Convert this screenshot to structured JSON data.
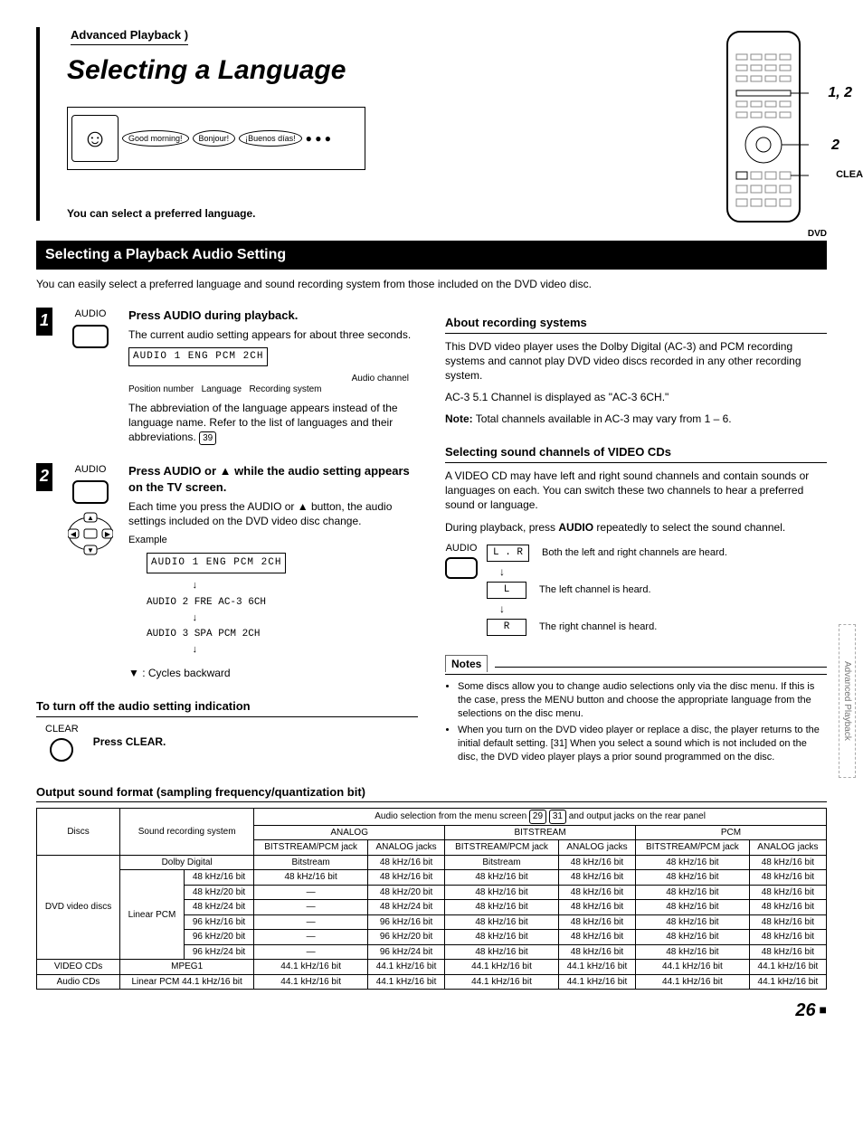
{
  "header": {
    "breadcrumb": "Advanced Playback",
    "title": "Selecting a Language",
    "greetings": [
      "Good morning!",
      "Bonjour!",
      "¡Buenos días!"
    ],
    "intro_note": "You can select a preferred language."
  },
  "remote": {
    "callout_12": "1, 2",
    "callout_2": "2",
    "callout_clear": "CLEAR"
  },
  "section1": {
    "bar": "Selecting a Playback Audio Setting",
    "dvd_tag": "DVD",
    "lead": "You can easily select a preferred language and sound recording system from those included on the DVD video disc."
  },
  "step1": {
    "num": "1",
    "label": "AUDIO",
    "heading": "Press AUDIO during playback.",
    "p1": "The current audio setting appears for about three seconds.",
    "display": "AUDIO 1 ENG PCM 2CH",
    "caption_audio_channel": "Audio channel",
    "caption_position": "Position number",
    "caption_language": "Language",
    "caption_recsys": "Recording system",
    "p2": "The abbreviation of the language appears instead of the language name. Refer to the list of languages and their abbreviations.",
    "ref": "39"
  },
  "step2": {
    "num": "2",
    "label": "AUDIO",
    "heading": "Press AUDIO or ▲ while the audio setting appears on the TV screen.",
    "p1": "Each time you press the AUDIO or ▲ button, the audio settings included on the DVD video disc change.",
    "example_label": "Example",
    "examples": [
      "AUDIO 1 ENG PCM 2CH",
      "AUDIO 2 FRE AC-3 6CH",
      "AUDIO 3 SPA PCM 2CH"
    ],
    "cycles": "▼ : Cycles backward"
  },
  "turnoff": {
    "heading": "To turn off the audio setting indication",
    "label": "CLEAR",
    "instruction": "Press CLEAR."
  },
  "about": {
    "heading": "About recording systems",
    "p1": "This DVD video player uses the Dolby Digital (AC-3) and PCM recording systems and cannot play DVD video discs recorded in any other recording system.",
    "p2": "AC-3 5.1 Channel is displayed as \"AC-3 6CH.\"",
    "note_label": "Note:",
    "note": "Total channels available in AC-3 may vary from 1 – 6."
  },
  "vcd": {
    "heading": "Selecting sound channels of VIDEO CDs",
    "p1": "A VIDEO CD may have left and right sound channels and contain sounds or languages on each. You can switch these two channels to hear a preferred sound or language.",
    "p2_pre": "During playback, press ",
    "p2_bold": "AUDIO",
    "p2_post": " repeatedly to select the sound channel.",
    "label": "AUDIO",
    "channels": [
      {
        "code": "L . R",
        "desc": "Both the left and right channels are heard."
      },
      {
        "code": "L",
        "desc": "The left channel is heard."
      },
      {
        "code": "R",
        "desc": "The right channel is heard."
      }
    ]
  },
  "notes": {
    "heading": "Notes",
    "items": [
      "Some discs allow you to change audio selections only via the disc menu. If this is the case, press the MENU button and choose the appropriate language from the selections on the disc menu.",
      "When you turn on the DVD video player or replace a disc, the player returns to the initial default setting. [31]  When you select a sound which is not included on the disc, the DVD video player plays a prior sound programmed on the disc."
    ]
  },
  "output": {
    "heading": "Output sound format (sampling frequency/quantization bit)",
    "top_header_pre": "Audio selection from the menu screen ",
    "top_header_ref1": "29",
    "top_header_ref2": "31",
    "top_header_post": " and output jacks on the rear panel",
    "col_discs": "Discs",
    "col_srs": "Sound recording system",
    "groups": [
      "ANALOG",
      "BITSTREAM",
      "PCM"
    ],
    "sub_cols": [
      "BITSTREAM/PCM jack",
      "ANALOG jacks"
    ],
    "rows": [
      {
        "disc": "DVD video discs",
        "srs": "Dolby Digital",
        "srs2": "",
        "v": [
          "Bitstream",
          "48 kHz/16 bit",
          "Bitstream",
          "48 kHz/16 bit",
          "48 kHz/16 bit",
          "48 kHz/16 bit"
        ]
      },
      {
        "disc": "",
        "srs": "Linear PCM",
        "srs2": "48 kHz/16 bit",
        "v": [
          "48 kHz/16 bit",
          "48 kHz/16 bit",
          "48 kHz/16 bit",
          "48 kHz/16 bit",
          "48 kHz/16 bit",
          "48 kHz/16 bit"
        ]
      },
      {
        "disc": "",
        "srs": "",
        "srs2": "48 kHz/20 bit",
        "v": [
          "—",
          "48 kHz/20 bit",
          "48 kHz/16 bit",
          "48 kHz/16 bit",
          "48 kHz/16 bit",
          "48 kHz/16 bit"
        ]
      },
      {
        "disc": "",
        "srs": "",
        "srs2": "48 kHz/24 bit",
        "v": [
          "—",
          "48 kHz/24 bit",
          "48 kHz/16 bit",
          "48 kHz/16 bit",
          "48 kHz/16 bit",
          "48 kHz/16 bit"
        ]
      },
      {
        "disc": "",
        "srs": "",
        "srs2": "96 kHz/16 bit",
        "v": [
          "—",
          "96 kHz/16 bit",
          "48 kHz/16 bit",
          "48 kHz/16 bit",
          "48 kHz/16 bit",
          "48 kHz/16 bit"
        ]
      },
      {
        "disc": "",
        "srs": "",
        "srs2": "96 kHz/20 bit",
        "v": [
          "—",
          "96 kHz/20 bit",
          "48 kHz/16 bit",
          "48 kHz/16 bit",
          "48 kHz/16 bit",
          "48 kHz/16 bit"
        ]
      },
      {
        "disc": "",
        "srs": "",
        "srs2": "96 kHz/24 bit",
        "v": [
          "—",
          "96 kHz/24 bit",
          "48 kHz/16 bit",
          "48 kHz/16 bit",
          "48 kHz/16 bit",
          "48 kHz/16 bit"
        ]
      },
      {
        "disc": "VIDEO CDs",
        "srs": "MPEG1",
        "srs2": "",
        "v": [
          "44.1 kHz/16 bit",
          "44.1 kHz/16 bit",
          "44.1 kHz/16 bit",
          "44.1 kHz/16 bit",
          "44.1 kHz/16 bit",
          "44.1 kHz/16 bit"
        ]
      },
      {
        "disc": "Audio CDs",
        "srs": "Linear PCM 44.1 kHz/16 bit",
        "srs2": "",
        "v": [
          "44.1 kHz/16 bit",
          "44.1 kHz/16 bit",
          "44.1 kHz/16 bit",
          "44.1 kHz/16 bit",
          "44.1 kHz/16 bit",
          "44.1 kHz/16 bit"
        ]
      }
    ]
  },
  "side_tab": "Advanced Playback",
  "page_number": "26"
}
